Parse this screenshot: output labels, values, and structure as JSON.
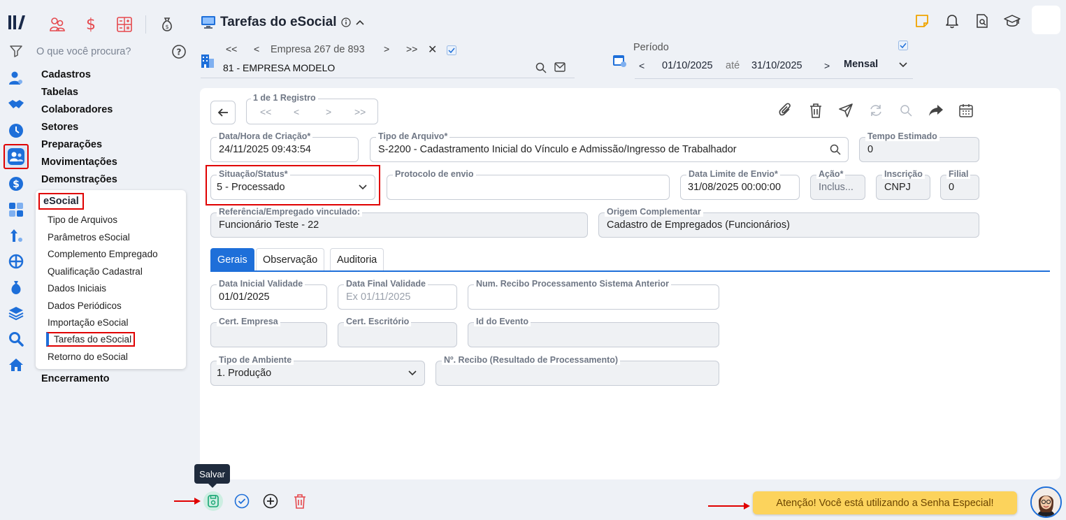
{
  "sidebar": {
    "search_placeholder": "O que você procura?",
    "categories": [
      "Cadastros",
      "Tabelas",
      "Colaboradores",
      "Setores",
      "Preparações",
      "Movimentações",
      "Demonstrações"
    ],
    "esocial": {
      "title": "eSocial",
      "items": [
        "Tipo de Arquivos",
        "Parâmetros eSocial",
        "Complemento Empregado",
        "Qualificação Cadastral",
        "Dados Iniciais",
        "Dados Periódicos",
        "Importação eSocial",
        "Tarefas do eSocial",
        "Retorno do eSocial"
      ]
    },
    "last_category": "Encerramento"
  },
  "header": {
    "title": "Tarefas do eSocial",
    "empresa": {
      "label": "Empresa",
      "current": "267",
      "of": "de",
      "total": "893",
      "name": "81 - EMPRESA MODELO"
    },
    "periodo": {
      "label": "Período",
      "start": "01/10/2025",
      "until": "até",
      "end": "31/10/2025",
      "mode": "Mensal"
    }
  },
  "record_nav": {
    "label": "1 de 1 Registro"
  },
  "form": {
    "created": {
      "label": "Data/Hora de Criação*",
      "value": "24/11/2025 09:43:54"
    },
    "file_type": {
      "label": "Tipo de Arquivo*",
      "value": "S-2200 - Cadastramento Inicial do Vínculo e Admissão/Ingresso de Trabalhador"
    },
    "estimated_time": {
      "label": "Tempo Estimado",
      "value": "0"
    },
    "status": {
      "label": "Situação/Status*",
      "value": "5 - Processado"
    },
    "protocol": {
      "label": "Protocolo de envio",
      "value": ""
    },
    "deadline": {
      "label": "Data Limite de Envio*",
      "value": "31/08/2025 00:00:00"
    },
    "action": {
      "label": "Ação*",
      "value": "Inclus..."
    },
    "inscricao": {
      "label": "Inscrição",
      "value": "CNPJ"
    },
    "filial": {
      "label": "Filial",
      "value": "0"
    },
    "reference": {
      "label": "Referência/Empregado vinculado:",
      "value": "Funcionário Teste - 22"
    },
    "origin": {
      "label": "Origem Complementar",
      "value": "Cadastro de Empregados (Funcionários)"
    }
  },
  "tabs": [
    "Gerais",
    "Observação",
    "Auditoria"
  ],
  "gerais": {
    "start_validity": {
      "label": "Data Inicial Validade",
      "value": "01/01/2025"
    },
    "end_validity": {
      "label": "Data Final Validade",
      "placeholder": "Ex 01/11/2025"
    },
    "prev_receipt": {
      "label": "Num. Recibo Processamento Sistema Anterior",
      "value": ""
    },
    "cert_company": {
      "label": "Cert. Empresa",
      "value": ""
    },
    "cert_office": {
      "label": "Cert. Escritório",
      "value": ""
    },
    "event_id": {
      "label": "Id do Evento",
      "value": ""
    },
    "environment": {
      "label": "Tipo de Ambiente",
      "value": "1. Produção"
    },
    "receipt_result": {
      "label": "Nº. Recibo (Resultado de Processamento)",
      "value": ""
    }
  },
  "footer": {
    "save_tooltip": "Salvar",
    "warning": "Atenção! Você está utilizando a Senha Especial!"
  },
  "colors": {
    "accent": "#1e6fd9",
    "highlight": "#e00000",
    "warning": "#fcd35c",
    "danger": "#e5484d"
  }
}
